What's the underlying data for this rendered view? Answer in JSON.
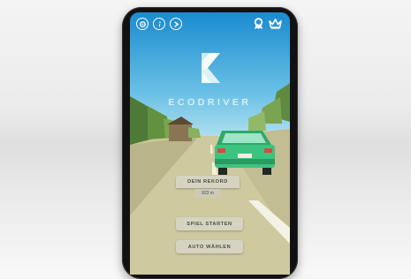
{
  "app": {
    "brand_name": "ECODRIVER"
  },
  "topbar": {
    "left_icons": [
      "gear-icon",
      "info-icon",
      "share-icon"
    ],
    "right_icons": [
      "award-ribbon-icon",
      "crown-icon"
    ],
    "icon_color": "#ffffff"
  },
  "record": {
    "label": "DEIN REKORD",
    "value": "923 m"
  },
  "menu": {
    "start_label": "SPIEL STARTEN",
    "choose_car_label": "AUTO WÄHLEN"
  },
  "colors": {
    "sky_top": "#1e8fd0",
    "sky_bottom": "#bfe6f3",
    "road": "#d6d1a9",
    "car": "#39c07a",
    "phone_body": "#111111",
    "button_bg": "#d7d4c3",
    "button_text": "#4c4b42"
  }
}
